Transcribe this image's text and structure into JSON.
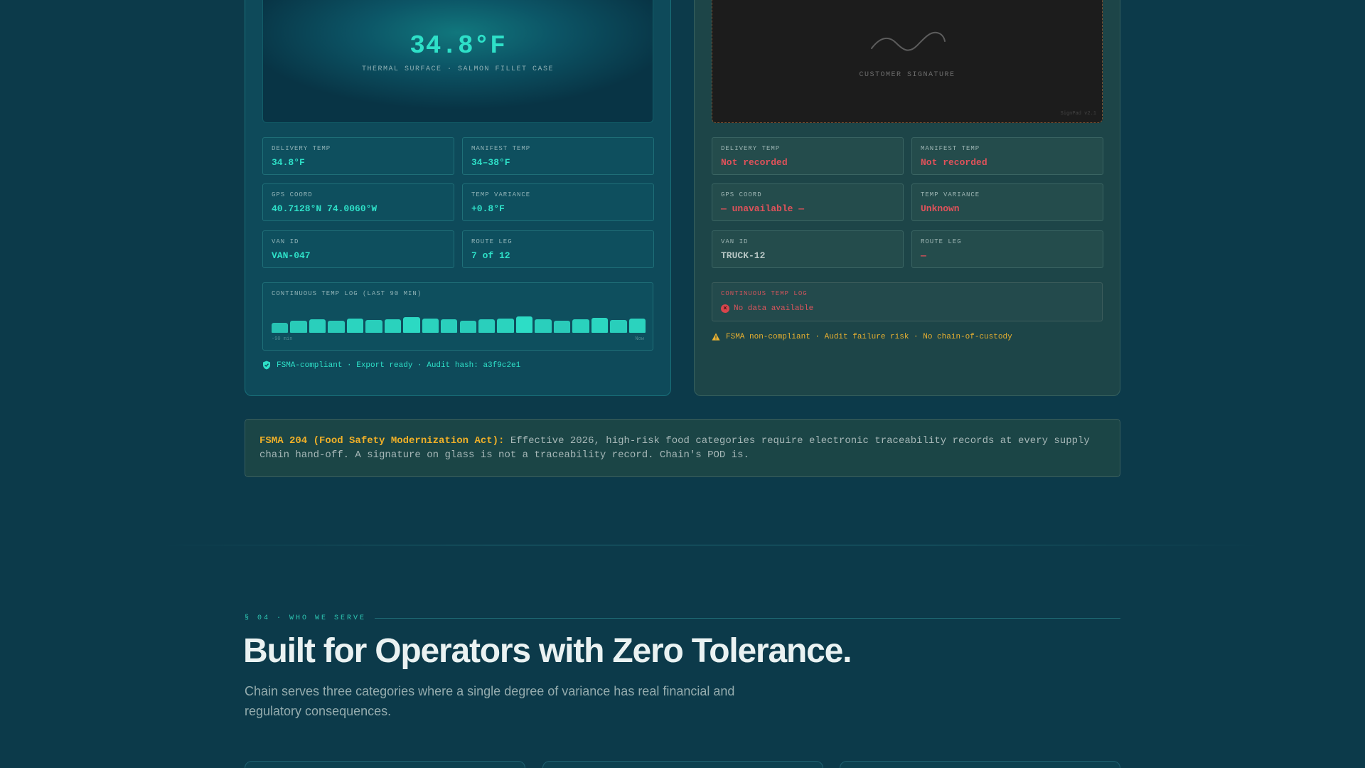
{
  "left_panel": {
    "hero_value": "34.8°F",
    "hero_caption": "THERMAL SURFACE · SALMON FILLET CASE",
    "metrics": [
      {
        "label": "DELIVERY TEMP",
        "value": "34.8°F"
      },
      {
        "label": "MANIFEST TEMP",
        "value": "34–38°F"
      },
      {
        "label": "GPS COORD",
        "value": "40.7128°N 74.0060°W"
      },
      {
        "label": "TEMP VARIANCE",
        "value": "+0.8°F"
      },
      {
        "label": "VAN ID",
        "value": "VAN-047"
      },
      {
        "label": "ROUTE LEG",
        "value": "7 of 12"
      }
    ],
    "log": {
      "label": "CONTINUOUS TEMP LOG (LAST 90 MIN)",
      "axis_start": "-90 min",
      "axis_end": "Now",
      "levels": [
        0.45,
        0.55,
        0.62,
        0.55,
        0.68,
        0.6,
        0.64,
        0.72,
        0.66,
        0.62,
        0.58,
        0.62,
        0.66,
        0.78,
        0.62,
        0.56,
        0.64,
        0.7,
        0.6,
        0.66
      ]
    },
    "status": "FSMA-compliant · Export ready · Audit hash: a3f9c2e1",
    "colors": {
      "accent": "#2ee0c8"
    }
  },
  "right_panel": {
    "signature_caption": "CUSTOMER SIGNATURE",
    "signature_brand": "SignPad v2.1",
    "metrics": [
      {
        "label": "DELIVERY TEMP",
        "value": "Not recorded",
        "tone": "red"
      },
      {
        "label": "MANIFEST TEMP",
        "value": "Not recorded",
        "tone": "red"
      },
      {
        "label": "GPS COORD",
        "value": "— unavailable —",
        "tone": "red"
      },
      {
        "label": "TEMP VARIANCE",
        "value": "Unknown",
        "tone": "red"
      },
      {
        "label": "VAN ID",
        "value": "TRUCK-12",
        "tone": "grey"
      },
      {
        "label": "ROUTE LEG",
        "value": "—",
        "tone": "red"
      }
    ],
    "log": {
      "label": "CONTINUOUS TEMP LOG",
      "empty_text": "No data available"
    },
    "status": "FSMA non-compliant · Audit failure risk · No chain-of-custody",
    "colors": {
      "error": "#e0525a",
      "warning": "#e8b030"
    }
  },
  "note": {
    "heading": "FSMA 204 (Food Safety Modernization Act):",
    "body": " Effective 2026, high-risk food categories require electronic traceability records at every supply chain hand-off. A signature on glass is not a traceability record. Chain's POD is."
  },
  "section": {
    "eyebrow": "§ 04 · WHO WE SERVE",
    "title": "Built for Operators with Zero Tolerance.",
    "subtitle": "Chain serves three categories where a single degree of variance has real financial and regulatory consequences."
  },
  "icons": {
    "left_status": "shield-check-icon",
    "right_status": "warning-icon",
    "log_empty": "error-circle-icon"
  }
}
